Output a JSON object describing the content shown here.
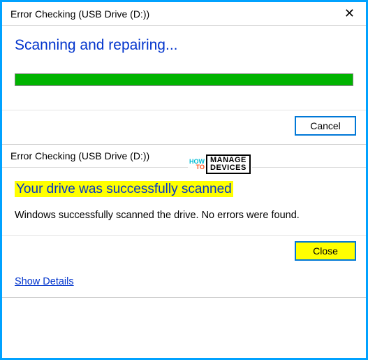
{
  "dialog1": {
    "title": "Error Checking (USB Drive (D:))",
    "status": "Scanning and repairing...",
    "cancel_label": "Cancel"
  },
  "dialog2": {
    "title": "Error Checking (USB Drive (D:))",
    "result_heading": "Your drive was successfully scanned",
    "result_text": "Windows successfully scanned the drive. No errors were found.",
    "close_label": "Close",
    "show_details": "Show Details"
  },
  "watermark": {
    "how": "HOW",
    "to": "TO",
    "line1": "MANAGE",
    "line2": "DEVICES"
  }
}
